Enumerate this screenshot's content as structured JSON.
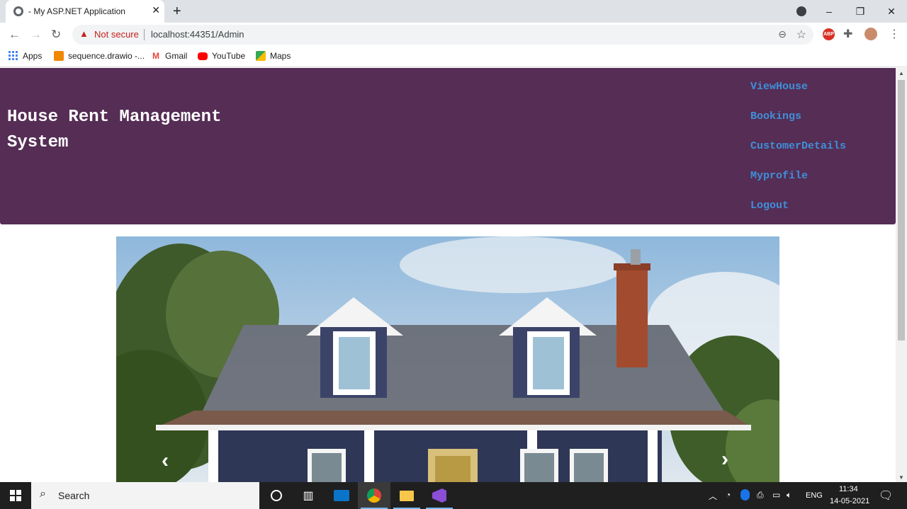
{
  "browser": {
    "tab_title": "- My ASP.NET Application",
    "new_tab_label": "+",
    "window_controls": [
      "–",
      "❐",
      "✕"
    ],
    "security_label": "Not secure",
    "url": "localhost:44351/Admin",
    "bookmarks": [
      {
        "label": "Apps",
        "icon": "apps-grid-icon",
        "color": "#4285f4"
      },
      {
        "label": "sequence.drawio -...",
        "icon": "drawio-icon",
        "color": "#f08705"
      },
      {
        "label": "Gmail",
        "icon": "gmail-icon",
        "color": "#ea4335"
      },
      {
        "label": "YouTube",
        "icon": "youtube-icon",
        "color": "#ff0000"
      },
      {
        "label": "Maps",
        "icon": "maps-icon",
        "color": "#34a853"
      }
    ],
    "extensions": {
      "abp_label": "ABP"
    }
  },
  "page": {
    "brand": "House Rent Management System",
    "nav": [
      "ViewHouse",
      "Bookings",
      "CustomerDetails",
      "Myprofile",
      "Logout"
    ],
    "colors": {
      "header_bg": "#552d55",
      "nav_link": "#3f8fd9"
    },
    "carousel": {
      "prev_label": "‹",
      "next_label": "›"
    }
  },
  "taskbar": {
    "search_label": "Search",
    "apps": [
      "cortana-icon",
      "task-view-icon",
      "mail-icon",
      "chrome-icon",
      "file-explorer-icon",
      "visual-studio-icon"
    ],
    "language": "ENG",
    "time": "11:34",
    "date": "14-05-2021"
  }
}
